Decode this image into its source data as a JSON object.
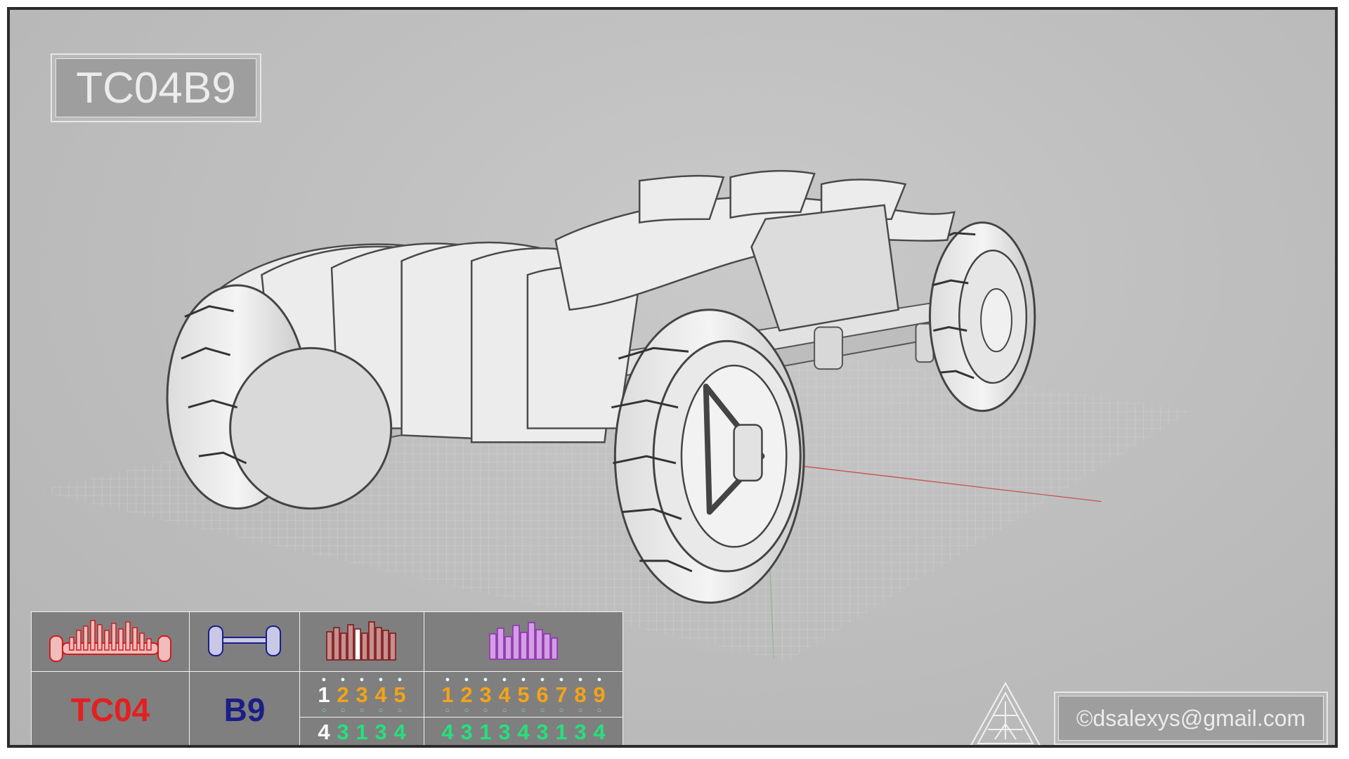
{
  "title": "TC04B9",
  "footer_email": "©dsalexys@gmail.com",
  "colors": {
    "code_red": "#e41f1f",
    "code_blue": "#1b1e87",
    "digit_orange": "#f4a318",
    "digit_green": "#25e07b",
    "chart_purple": "#b14fd6"
  },
  "spec_table": {
    "icons": [
      "body-profile-icon",
      "axle-icon",
      "bar-chart-icon",
      "purple-bar-chart-icon"
    ],
    "code_body": "TC04",
    "code_axle": "B9",
    "set_a": {
      "digits": [
        "1",
        "2",
        "3",
        "4",
        "5"
      ],
      "counts": [
        "4",
        "3",
        "1",
        "3",
        "4"
      ]
    },
    "set_b": {
      "digits": [
        "1",
        "2",
        "3",
        "4",
        "5",
        "6",
        "7",
        "8",
        "9"
      ],
      "counts": [
        "4",
        "3",
        "1",
        "3",
        "4",
        "3",
        "1",
        "3",
        "4"
      ]
    }
  }
}
